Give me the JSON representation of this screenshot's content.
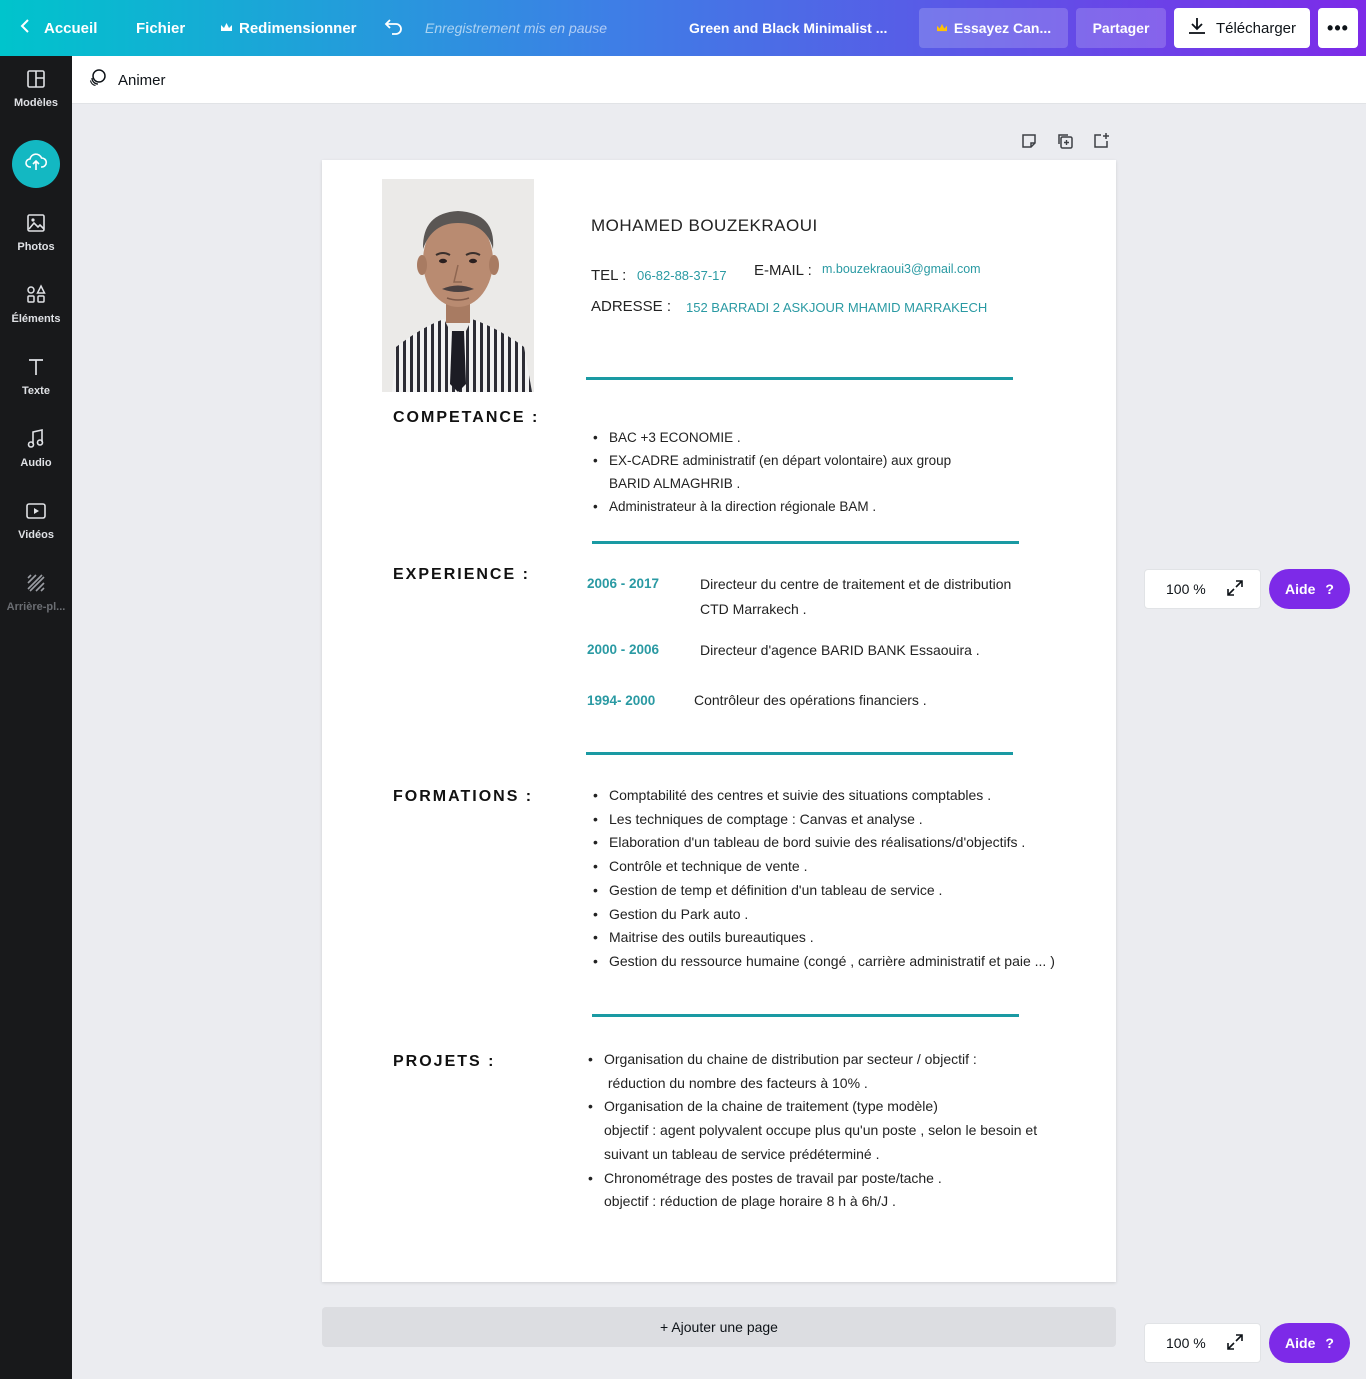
{
  "topbar": {
    "home_label": "Accueil",
    "file_label": "Fichier",
    "resize_label": "Redimensionner",
    "save_status": "Enregistrement mis en pause",
    "doc_title": "Green and Black Minimalist ...",
    "try_label": "Essayez Can...",
    "share_label": "Partager",
    "download_label": "Télécharger",
    "more_label": "•••"
  },
  "sidebar": {
    "items": [
      {
        "label": "Modèles",
        "icon": "layout-icon"
      },
      {
        "label": "",
        "icon": "upload-icon"
      },
      {
        "label": "Photos",
        "icon": "image-icon"
      },
      {
        "label": "Éléments",
        "icon": "shapes-icon"
      },
      {
        "label": "Texte",
        "icon": "text-icon"
      },
      {
        "label": "Audio",
        "icon": "music-icon"
      },
      {
        "label": "Vidéos",
        "icon": "video-icon"
      },
      {
        "label": "Arrière-pl...",
        "icon": "background-icon"
      }
    ]
  },
  "subbar": {
    "animate_label": "Animer"
  },
  "cv": {
    "name": "MOHAMED BOUZEKRAOUI",
    "tel_label": "TEL :",
    "tel_value": "06-82-88-37-17",
    "email_label": "E-MAIL :",
    "email_value": "m.bouzekraoui3@gmail.com",
    "address_label": "ADRESSE :",
    "address_value": "152 BARRADI 2 ASKJOUR MHAMID MARRAKECH",
    "competence": {
      "title": "COMPETANCE :",
      "items": [
        "BAC +3 ECONOMIE .",
        "EX-CADRE administratif (en départ volontaire) aux group",
        "BARID ALMAGHRIB .",
        "Administrateur à la direction régionale BAM ."
      ]
    },
    "experience": {
      "title": "EXPERIENCE :",
      "items": [
        {
          "years": "2006 - 2017",
          "line1": "Directeur du centre de traitement et de distribution",
          "line2": "CTD Marrakech ."
        },
        {
          "years": "2000 - 2006",
          "line1": "Directeur d'agence BARID BANK Essaouira ."
        },
        {
          "years": "1994- 2000",
          "line1": "Contrôleur des opérations financiers  ."
        }
      ]
    },
    "formations": {
      "title": "FORMATIONS :",
      "items": [
        "Comptabilité des centres et suivie des situations comptables .",
        "Les techniques de comptage  : Canvas et analyse .",
        "Elaboration d'un tableau de bord suivie des réalisations/d'objectifs .",
        "Contrôle et technique  de vente .",
        "Gestion de temp et définition d'un tableau de service .",
        "Gestion du Park auto .",
        "Maitrise des outils bureautiques .",
        "Gestion du ressource humaine  (congé , carrière administratif et paie ... )"
      ]
    },
    "projets": {
      "title": "PROJETS   :",
      "items": [
        {
          "l1": "Organisation du chaine de distribution par secteur / objectif :",
          "l2": " réduction du nombre des facteurs à 10% ."
        },
        {
          "l1": "Organisation de la chaine de traitement (type modèle)",
          "l2": "objectif : agent polyvalent occupe plus qu'un poste , selon le besoin et",
          "l3": "suivant un tableau de service prédéterminé ."
        },
        {
          "l1": "Chronométrage des postes de travail par poste/tache .",
          "l2": "objectif : réduction de plage horaire 8 h à 6h/J  ."
        }
      ]
    }
  },
  "add_page_label": "+ Ajouter une page",
  "zoom_value": "100 %",
  "help_label": "Aide",
  "help_symbol": "?",
  "colors": {
    "accent": "#1a9aa3",
    "purple": "#7d2ae8",
    "sidebar": "#18191b"
  }
}
